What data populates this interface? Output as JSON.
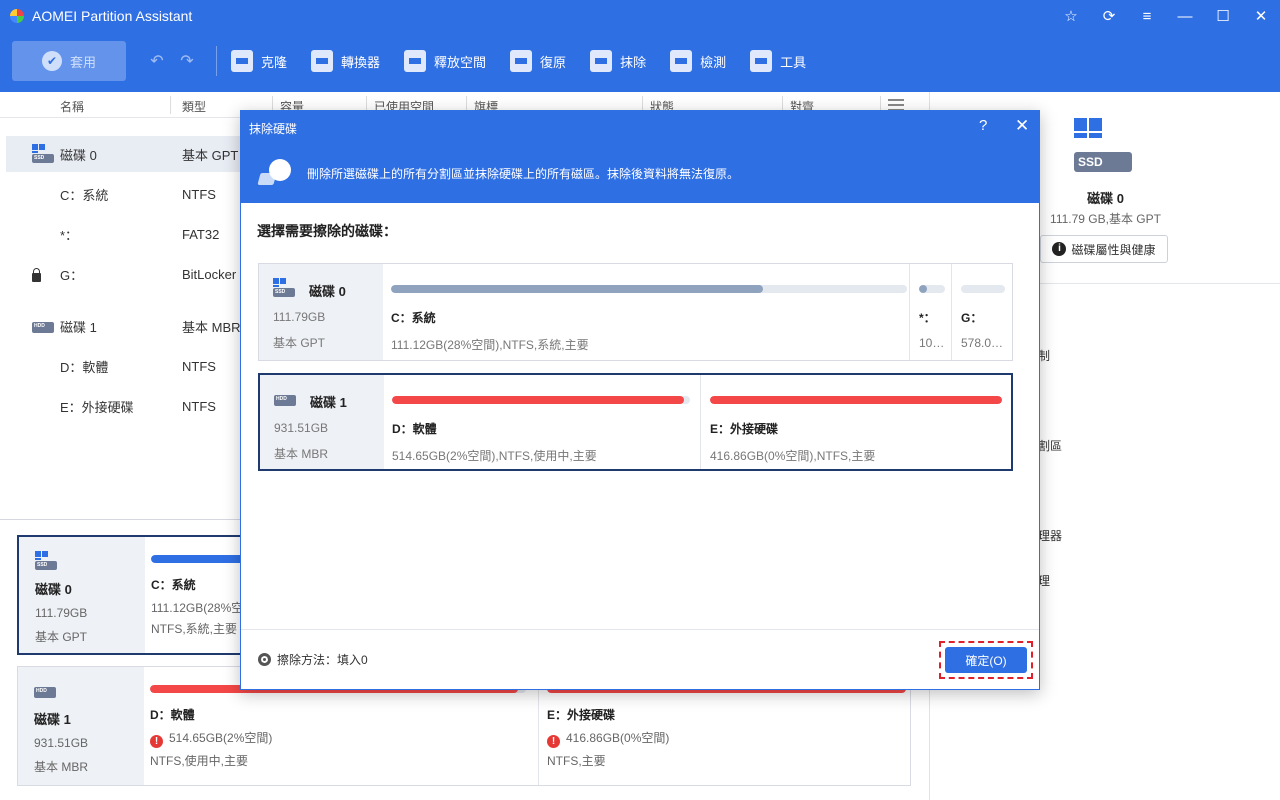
{
  "app": {
    "title": "AOMEI Partition Assistant"
  },
  "window_controls": [
    "☆",
    "⟳",
    "≡",
    "—",
    "☐",
    "✕"
  ],
  "toolbar": {
    "apply": "套用",
    "items": [
      {
        "label": "克隆",
        "icon": "clone-icon"
      },
      {
        "label": "轉換器",
        "icon": "convert-icon"
      },
      {
        "label": "釋放空間",
        "icon": "free-space-icon"
      },
      {
        "label": "復原",
        "icon": "recover-icon"
      },
      {
        "label": "抹除",
        "icon": "wipe-icon"
      },
      {
        "label": "檢測",
        "icon": "test-icon"
      },
      {
        "label": "工具",
        "icon": "tools-icon"
      }
    ]
  },
  "columns": [
    "名稱",
    "類型",
    "容量",
    "已使用空間",
    "旗標",
    "狀態",
    "對齊"
  ],
  "rows": [
    {
      "name": "磁碟 0",
      "type": "基本 GPT",
      "kind": "ssd"
    },
    {
      "name": "C：系統",
      "type": "NTFS"
    },
    {
      "name": "*：",
      "type": "FAT32"
    },
    {
      "name": "G：",
      "type": "BitLocker",
      "locked": true
    },
    {
      "name": "磁碟 1",
      "type": "基本 MBR",
      "kind": "hdd"
    },
    {
      "name": "D：軟體",
      "type": "NTFS"
    },
    {
      "name": "E：外接硬碟",
      "type": "NTFS"
    }
  ],
  "disk_cards": [
    {
      "name": "磁碟 0",
      "size": "111.79GB",
      "type": "基本 GPT",
      "kind": "SSD",
      "partition": {
        "name": "C：系統",
        "info1": "111.12GB(28%空",
        "info2": "NTFS,系統,主要",
        "used": 0.72,
        "color": "#2f6fe4"
      }
    },
    {
      "name": "磁碟 1",
      "size": "931.51GB",
      "type": "基本 MBR",
      "kind": "HDD",
      "partitions": [
        {
          "name": "D：軟體",
          "info1": "514.65GB(2%空間)",
          "info2": "NTFS,使用中,主要",
          "used": 0.98,
          "color": "#f44747"
        },
        {
          "name": "E：外接硬碟",
          "info1": "416.86GB(0%空間)",
          "info2": "NTFS,主要",
          "used": 1.0,
          "color": "#f44747"
        }
      ]
    }
  ],
  "right_panel": {
    "disk_kind": "SSD",
    "name": "磁碟 0",
    "info": "111.79 GB,基本 GPT",
    "props_button": "磁碟屬性與健康",
    "ops": [
      "制",
      "割區",
      "理器",
      "理"
    ]
  },
  "dialog": {
    "title": "抹除硬碟",
    "help": "?",
    "close": "✕",
    "description": "刪除所選磁碟上的所有分割區並抹除硬碟上的所有磁區。抹除後資料將無法復原。",
    "subtitle": "選擇需要擦除的磁碟：",
    "disks": [
      {
        "name": "磁碟 0",
        "size": "111.79GB",
        "type": "基本 GPT",
        "kind": "SSD",
        "partitions": [
          {
            "name": "C：系統",
            "info": "111.12GB(28%空間),NTFS,系統,主要",
            "used": 0.72,
            "color": "#8fa3bf"
          },
          {
            "name": "*：",
            "info": "101...",
            "used": 0.3,
            "color": "#8fa3bf"
          },
          {
            "name": "G：",
            "info": "578.00...",
            "used": 0.0,
            "color": "#8fa3bf"
          }
        ]
      },
      {
        "name": "磁碟 1",
        "size": "931.51GB",
        "type": "基本 MBR",
        "kind": "HDD",
        "partitions": [
          {
            "name": "D：軟體",
            "info": "514.65GB(2%空間),NTFS,使用中,主要",
            "used": 0.98,
            "color": "#f44747"
          },
          {
            "name": "E：外接硬碟",
            "info": "416.86GB(0%空間),NTFS,主要",
            "used": 1.0,
            "color": "#f44747"
          }
        ]
      }
    ],
    "wipe_method": "擦除方法：填入0",
    "ok": "確定(O)"
  }
}
